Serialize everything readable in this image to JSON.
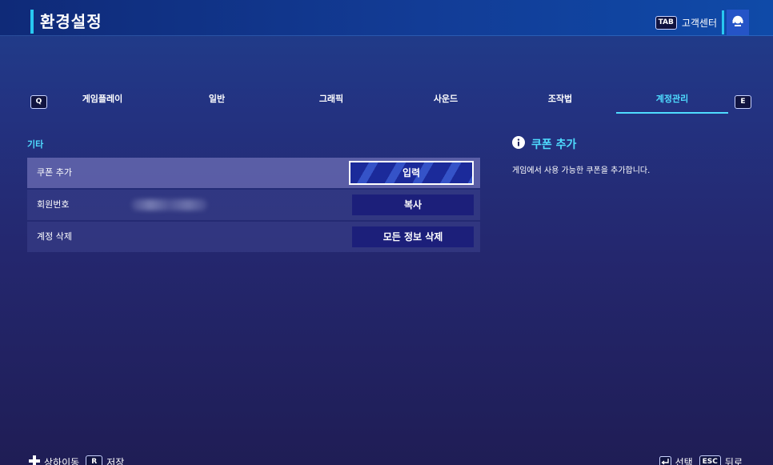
{
  "header": {
    "title": "환경설정",
    "support_key": "TAB",
    "support_label": "고객센터",
    "support_icon": "headset-icon"
  },
  "tabs": {
    "prev_key": "Q",
    "next_key": "E",
    "items": [
      {
        "label": "게임플레이"
      },
      {
        "label": "일반"
      },
      {
        "label": "그래픽"
      },
      {
        "label": "사운드"
      },
      {
        "label": "조작법"
      },
      {
        "label": "계정관리",
        "active": true
      }
    ]
  },
  "section": {
    "label": "기타",
    "rows": [
      {
        "label": "쿠폰 추가",
        "button": "입력",
        "selected": true
      },
      {
        "label": "회원번호",
        "button": "복사",
        "value_hidden": true
      },
      {
        "label": "계정 삭제",
        "button": "모든 정보 삭제"
      }
    ]
  },
  "info": {
    "icon": "info-icon",
    "title": "쿠폰 추가",
    "description": "게임에서 사용 가능한 쿠폰을 추가합니다."
  },
  "footer": {
    "left": [
      {
        "icon": "dpad-icon",
        "label": "상하이동"
      },
      {
        "key": "R",
        "label": "저장"
      }
    ],
    "right": [
      {
        "icon": "enter-icon",
        "label": "선택"
      },
      {
        "key": "ESC",
        "label": "뒤로"
      }
    ]
  },
  "colors": {
    "accent": "#4fdcff",
    "header_bg": "#123c96",
    "selected_button": "#1b2a9a"
  }
}
